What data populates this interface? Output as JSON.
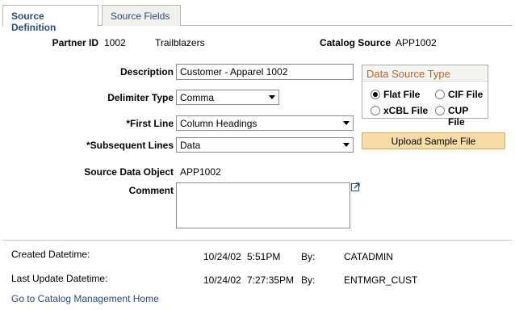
{
  "tabs": [
    {
      "label": "Source Definition",
      "active": true
    },
    {
      "label": "Source Fields",
      "active": false
    }
  ],
  "partner": {
    "id_label": "Partner ID",
    "id_value": "1002",
    "name": "Trailblazers"
  },
  "catalog": {
    "label": "Catalog Source",
    "value": "APP1002"
  },
  "description": {
    "label": "Description",
    "value": "Customer - Apparel 1002"
  },
  "delimiter": {
    "label": "Delimiter Type",
    "value": "Comma"
  },
  "first_line": {
    "label": "*First Line",
    "value": "Column Headings"
  },
  "subsequent_lines": {
    "label": "*Subsequent Lines",
    "value": "Data"
  },
  "source_object": {
    "label": "Source Data Object",
    "value": "APP1002"
  },
  "comment": {
    "label": "Comment",
    "value": ""
  },
  "data_source_type": {
    "title": "Data Source Type",
    "options": [
      {
        "label": "Flat File",
        "selected": true
      },
      {
        "label": "CIF File",
        "selected": false
      },
      {
        "label": "xCBL File",
        "selected": false
      },
      {
        "label": "CUP File",
        "selected": false
      }
    ]
  },
  "upload_button": "Upload Sample File",
  "created": {
    "label": "Created Datetime:",
    "date": "10/24/02",
    "time": "5:51PM",
    "by_label": "By:",
    "by": "CATADMIN"
  },
  "updated": {
    "label": "Last Update Datetime:",
    "date": "10/24/02",
    "time": "7:27:35PM",
    "by_label": "By:",
    "by": "ENTMGR_CUST"
  },
  "footer_link": "Go to Catalog Management Home",
  "colors": {
    "link": "#2b4c7e",
    "group_title": "#c06020",
    "button_bg": "#f7dca6"
  }
}
